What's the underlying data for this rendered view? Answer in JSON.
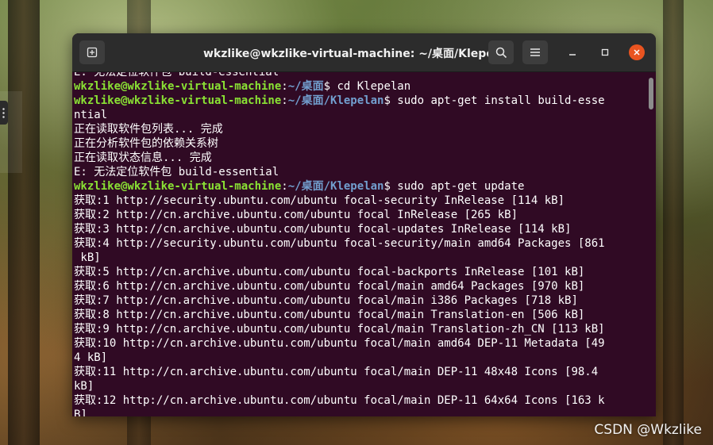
{
  "window": {
    "title": "wkzlike@wkzlike-virtual-machine: ~/桌面/Klepelan",
    "icons": {
      "new_tab": "new-tab-icon",
      "search": "search-icon",
      "menu": "hamburger-menu-icon",
      "minimize": "minimize-icon",
      "maximize": "maximize-icon",
      "close": "close-icon"
    }
  },
  "terminal": {
    "lines": [
      {
        "text": "E: 无法定位软件包 build-essential"
      },
      {
        "user": "wkzlike@wkzlike-virtual-machine",
        "sep": ":",
        "path": "~/桌面",
        "cmd": "$ cd Klepelan"
      },
      {
        "user": "wkzlike@wkzlike-virtual-machine",
        "sep": ":",
        "path": "~/桌面/Klepelan",
        "cmd": "$ sudo apt-get install build-esse"
      },
      {
        "text": "ntial"
      },
      {
        "text": "正在读取软件包列表... 完成"
      },
      {
        "text": "正在分析软件包的依赖关系树"
      },
      {
        "text": "正在读取状态信息... 完成"
      },
      {
        "text": "E: 无法定位软件包 build-essential"
      },
      {
        "user": "wkzlike@wkzlike-virtual-machine",
        "sep": ":",
        "path": "~/桌面/Klepelan",
        "cmd": "$ sudo apt-get update"
      },
      {
        "text": "获取:1 http://security.ubuntu.com/ubuntu focal-security InRelease [114 kB]"
      },
      {
        "text": "获取:2 http://cn.archive.ubuntu.com/ubuntu focal InRelease [265 kB]"
      },
      {
        "text": "获取:3 http://cn.archive.ubuntu.com/ubuntu focal-updates InRelease [114 kB]"
      },
      {
        "text": "获取:4 http://security.ubuntu.com/ubuntu focal-security/main amd64 Packages [861"
      },
      {
        "text": " kB]"
      },
      {
        "text": "获取:5 http://cn.archive.ubuntu.com/ubuntu focal-backports InRelease [101 kB]"
      },
      {
        "text": "获取:6 http://cn.archive.ubuntu.com/ubuntu focal/main amd64 Packages [970 kB]"
      },
      {
        "text": "获取:7 http://cn.archive.ubuntu.com/ubuntu focal/main i386 Packages [718 kB]"
      },
      {
        "text": "获取:8 http://cn.archive.ubuntu.com/ubuntu focal/main Translation-en [506 kB]"
      },
      {
        "text": "获取:9 http://cn.archive.ubuntu.com/ubuntu focal/main Translation-zh_CN [113 kB]"
      },
      {
        "text": "获取:10 http://cn.archive.ubuntu.com/ubuntu focal/main amd64 DEP-11 Metadata [49"
      },
      {
        "text": "4 kB]"
      },
      {
        "text": "获取:11 http://cn.archive.ubuntu.com/ubuntu focal/main DEP-11 48x48 Icons [98.4"
      },
      {
        "text": "kB]"
      },
      {
        "text": "获取:12 http://cn.archive.ubuntu.com/ubuntu focal/main DEP-11 64x64 Icons [163 k"
      },
      {
        "text": "B]"
      }
    ]
  },
  "watermark": "CSDN @Wkzlike",
  "colors": {
    "terminal_bg": "#300a24",
    "prompt_user": "#8ae234",
    "prompt_path": "#729fcf",
    "titlebar_bg": "#2c2c2c",
    "close_button": "#e95420"
  }
}
